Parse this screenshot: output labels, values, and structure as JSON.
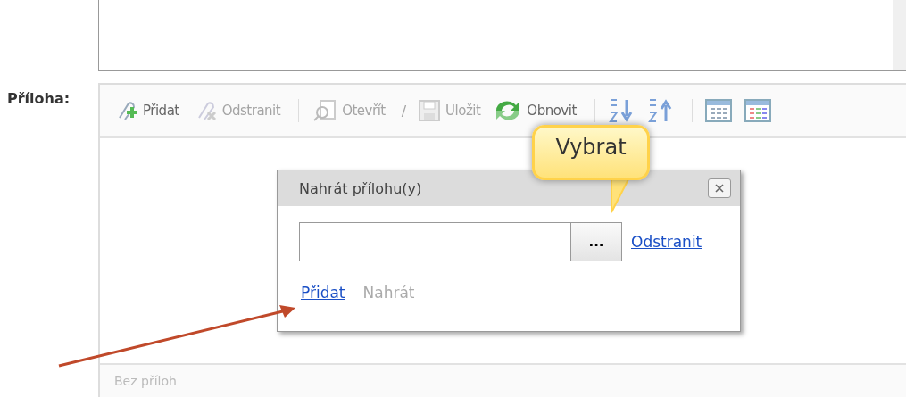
{
  "attachment_label": "Příloha:",
  "toolbar": [
    {
      "kind": "button",
      "label": "Přidat",
      "disabled": false
    },
    {
      "kind": "button",
      "label": "Odstranit",
      "disabled": true
    },
    {
      "kind": "separator"
    },
    {
      "kind": "button",
      "label": "Otevřít",
      "disabled": true
    },
    {
      "kind": "slash",
      "label": "/"
    },
    {
      "kind": "button",
      "label": "Uložit",
      "disabled": true
    },
    {
      "kind": "button",
      "label": "Obnovit",
      "disabled": false
    },
    {
      "kind": "separator"
    },
    {
      "kind": "icon",
      "disabled": false
    },
    {
      "kind": "icon",
      "disabled": false
    },
    {
      "kind": "separator"
    },
    {
      "kind": "icon",
      "disabled": false
    },
    {
      "kind": "icon",
      "disabled": false
    }
  ],
  "status": "Bez příloh",
  "dialog": {
    "title": "Nahrát přílohu(y)",
    "browse": "...",
    "remove": "Odstranit",
    "actions": [
      {
        "label": "Přidat",
        "disabled": false
      },
      {
        "label": "Nahrát",
        "disabled": true
      }
    ]
  },
  "tooltip": "Vybrat"
}
